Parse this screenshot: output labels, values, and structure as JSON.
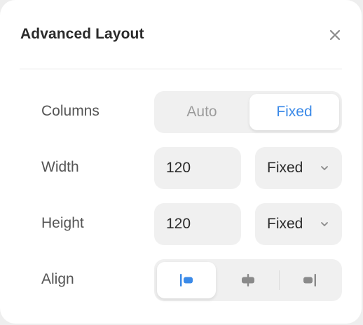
{
  "dialog": {
    "title": "Advanced Layout",
    "close_icon": "close-icon"
  },
  "rows": {
    "columns": {
      "label": "Columns",
      "options": [
        "Auto",
        "Fixed"
      ],
      "selected": "Fixed"
    },
    "width": {
      "label": "Width",
      "value": "120",
      "mode": "Fixed"
    },
    "height": {
      "label": "Height",
      "value": "120",
      "mode": "Fixed"
    },
    "align": {
      "label": "Align",
      "options": [
        "align-left-icon",
        "align-center-icon",
        "align-right-icon"
      ],
      "selected": "align-left-icon"
    }
  },
  "colors": {
    "accent": "#3b8ae8",
    "control_bg": "#f0f0f0",
    "icon_gray": "#8a8a8a"
  }
}
